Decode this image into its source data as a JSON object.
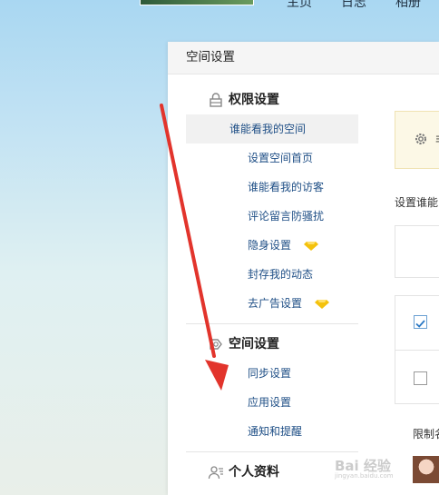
{
  "topnav": {
    "items": [
      "主页",
      "日志",
      "相册"
    ]
  },
  "panel": {
    "title": "空间设置"
  },
  "sidebar": {
    "groups": [
      {
        "title": "权限设置",
        "icon": "lock-icon",
        "items": [
          {
            "label": "谁能看我的空间",
            "selected": true
          },
          {
            "label": "设置空间首页"
          },
          {
            "label": "谁能看我的访客"
          },
          {
            "label": "评论留言防骚扰"
          },
          {
            "label": "隐身设置",
            "badge": "diamond-icon"
          },
          {
            "label": "封存我的动态"
          },
          {
            "label": "去广告设置",
            "badge": "diamond-icon"
          }
        ]
      },
      {
        "title": "空间设置",
        "icon": "settings-icon",
        "items": [
          {
            "label": "同步设置"
          },
          {
            "label": "应用设置"
          },
          {
            "label": "通知和提醒"
          }
        ]
      },
      {
        "title": "个人资料",
        "icon": "profile-icon",
        "items": []
      }
    ]
  },
  "content": {
    "notice_text": "非",
    "who_label": "设置谁能",
    "limit_label": "限制名"
  },
  "colors": {
    "link": "#1f4f86",
    "arrow": "#e2342c",
    "diamond": "#f4c20d"
  },
  "watermark": {
    "text": "Bai 经验",
    "sub": "jingyan.baidu.com"
  }
}
